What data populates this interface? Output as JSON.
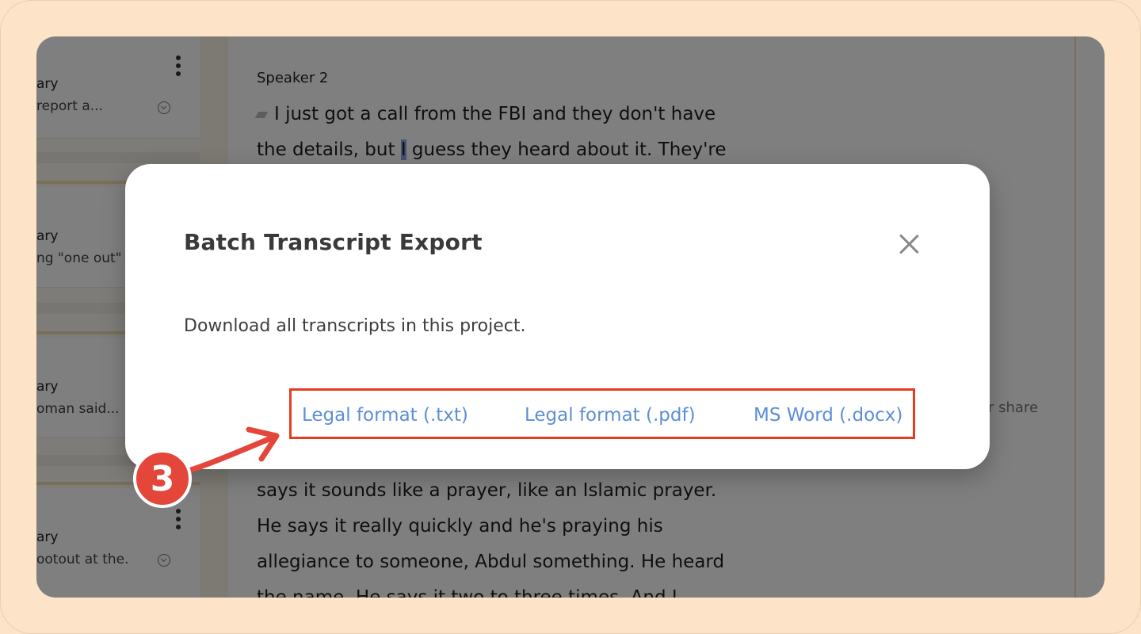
{
  "sidebar": {
    "cards": [
      {
        "title": "ary",
        "snippet": "report a..."
      },
      {
        "title": "ary",
        "snippet": "ng \"one out\""
      },
      {
        "title": "ary",
        "snippet": "oman said..."
      },
      {
        "title": "ary",
        "snippet": "ootout at the."
      }
    ]
  },
  "transcript": {
    "speaker": "Speaker 2",
    "lines_top": [
      "I just got a call from the FBI and they don't have",
      "the details, but",
      "guess they heard about it. They're"
    ],
    "highlight": "I",
    "lines_bottom": [
      "says it sounds like a prayer, like an Islamic prayer.",
      "He says it really quickly and he's praying his",
      "allegiance to someone, Abdul something. He heard",
      "the name. He says it two to three times.  And I"
    ]
  },
  "right_panel": {
    "text": "or share"
  },
  "modal": {
    "title": "Batch Transcript Export",
    "description": "Download all transcripts in this project.",
    "links": {
      "txt": "Legal format (.txt)",
      "pdf": "Legal format (.pdf)",
      "docx": "MS Word (.docx)"
    }
  },
  "annotation": {
    "step": "3",
    "color": "#e4463a",
    "box_color": "#e53d1f"
  },
  "colors": {
    "link": "#5c8fd6",
    "background": "#fde3c8"
  }
}
